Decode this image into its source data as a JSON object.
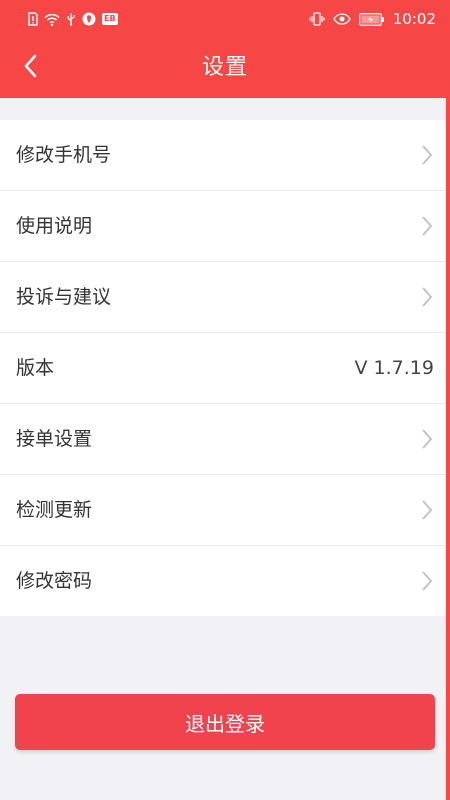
{
  "status_bar": {
    "badge": "EB",
    "time": "10:02",
    "icons": [
      "sim-alert-icon",
      "wifi-icon",
      "usb-icon",
      "location-icon",
      "vibrate-icon",
      "eye-icon",
      "battery-icon"
    ]
  },
  "header": {
    "title": "设置",
    "back_icon": "chevron-left-icon"
  },
  "settings": {
    "items": [
      {
        "label": "修改手机号",
        "chevron": true
      },
      {
        "label": "使用说明",
        "chevron": true
      },
      {
        "label": "投诉与建议",
        "chevron": true
      },
      {
        "label": "版本",
        "value": "V 1.7.19"
      },
      {
        "label": "接单设置",
        "chevron": true
      },
      {
        "label": "检测更新",
        "chevron": true
      },
      {
        "label": "修改密码",
        "chevron": true
      }
    ]
  },
  "logout": {
    "label": "退出登录"
  },
  "colors": {
    "primary": "#f64646",
    "button": "#f0434d",
    "background": "#f2f2f6",
    "text": "#333333"
  }
}
